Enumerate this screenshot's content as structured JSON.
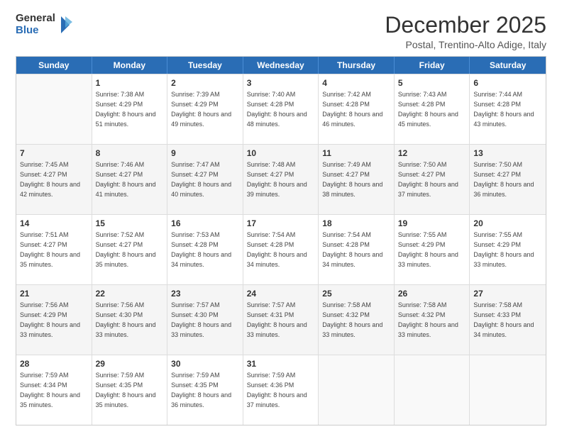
{
  "logo": {
    "general": "General",
    "blue": "Blue"
  },
  "title": "December 2025",
  "location": "Postal, Trentino-Alto Adige, Italy",
  "days": [
    "Sunday",
    "Monday",
    "Tuesday",
    "Wednesday",
    "Thursday",
    "Friday",
    "Saturday"
  ],
  "weeks": [
    [
      {
        "day": "",
        "sunrise": "",
        "sunset": "",
        "daylight": ""
      },
      {
        "day": "1",
        "sunrise": "Sunrise: 7:38 AM",
        "sunset": "Sunset: 4:29 PM",
        "daylight": "Daylight: 8 hours and 51 minutes."
      },
      {
        "day": "2",
        "sunrise": "Sunrise: 7:39 AM",
        "sunset": "Sunset: 4:29 PM",
        "daylight": "Daylight: 8 hours and 49 minutes."
      },
      {
        "day": "3",
        "sunrise": "Sunrise: 7:40 AM",
        "sunset": "Sunset: 4:28 PM",
        "daylight": "Daylight: 8 hours and 48 minutes."
      },
      {
        "day": "4",
        "sunrise": "Sunrise: 7:42 AM",
        "sunset": "Sunset: 4:28 PM",
        "daylight": "Daylight: 8 hours and 46 minutes."
      },
      {
        "day": "5",
        "sunrise": "Sunrise: 7:43 AM",
        "sunset": "Sunset: 4:28 PM",
        "daylight": "Daylight: 8 hours and 45 minutes."
      },
      {
        "day": "6",
        "sunrise": "Sunrise: 7:44 AM",
        "sunset": "Sunset: 4:28 PM",
        "daylight": "Daylight: 8 hours and 43 minutes."
      }
    ],
    [
      {
        "day": "7",
        "sunrise": "Sunrise: 7:45 AM",
        "sunset": "Sunset: 4:27 PM",
        "daylight": "Daylight: 8 hours and 42 minutes."
      },
      {
        "day": "8",
        "sunrise": "Sunrise: 7:46 AM",
        "sunset": "Sunset: 4:27 PM",
        "daylight": "Daylight: 8 hours and 41 minutes."
      },
      {
        "day": "9",
        "sunrise": "Sunrise: 7:47 AM",
        "sunset": "Sunset: 4:27 PM",
        "daylight": "Daylight: 8 hours and 40 minutes."
      },
      {
        "day": "10",
        "sunrise": "Sunrise: 7:48 AM",
        "sunset": "Sunset: 4:27 PM",
        "daylight": "Daylight: 8 hours and 39 minutes."
      },
      {
        "day": "11",
        "sunrise": "Sunrise: 7:49 AM",
        "sunset": "Sunset: 4:27 PM",
        "daylight": "Daylight: 8 hours and 38 minutes."
      },
      {
        "day": "12",
        "sunrise": "Sunrise: 7:50 AM",
        "sunset": "Sunset: 4:27 PM",
        "daylight": "Daylight: 8 hours and 37 minutes."
      },
      {
        "day": "13",
        "sunrise": "Sunrise: 7:50 AM",
        "sunset": "Sunset: 4:27 PM",
        "daylight": "Daylight: 8 hours and 36 minutes."
      }
    ],
    [
      {
        "day": "14",
        "sunrise": "Sunrise: 7:51 AM",
        "sunset": "Sunset: 4:27 PM",
        "daylight": "Daylight: 8 hours and 35 minutes."
      },
      {
        "day": "15",
        "sunrise": "Sunrise: 7:52 AM",
        "sunset": "Sunset: 4:27 PM",
        "daylight": "Daylight: 8 hours and 35 minutes."
      },
      {
        "day": "16",
        "sunrise": "Sunrise: 7:53 AM",
        "sunset": "Sunset: 4:28 PM",
        "daylight": "Daylight: 8 hours and 34 minutes."
      },
      {
        "day": "17",
        "sunrise": "Sunrise: 7:54 AM",
        "sunset": "Sunset: 4:28 PM",
        "daylight": "Daylight: 8 hours and 34 minutes."
      },
      {
        "day": "18",
        "sunrise": "Sunrise: 7:54 AM",
        "sunset": "Sunset: 4:28 PM",
        "daylight": "Daylight: 8 hours and 34 minutes."
      },
      {
        "day": "19",
        "sunrise": "Sunrise: 7:55 AM",
        "sunset": "Sunset: 4:29 PM",
        "daylight": "Daylight: 8 hours and 33 minutes."
      },
      {
        "day": "20",
        "sunrise": "Sunrise: 7:55 AM",
        "sunset": "Sunset: 4:29 PM",
        "daylight": "Daylight: 8 hours and 33 minutes."
      }
    ],
    [
      {
        "day": "21",
        "sunrise": "Sunrise: 7:56 AM",
        "sunset": "Sunset: 4:29 PM",
        "daylight": "Daylight: 8 hours and 33 minutes."
      },
      {
        "day": "22",
        "sunrise": "Sunrise: 7:56 AM",
        "sunset": "Sunset: 4:30 PM",
        "daylight": "Daylight: 8 hours and 33 minutes."
      },
      {
        "day": "23",
        "sunrise": "Sunrise: 7:57 AM",
        "sunset": "Sunset: 4:30 PM",
        "daylight": "Daylight: 8 hours and 33 minutes."
      },
      {
        "day": "24",
        "sunrise": "Sunrise: 7:57 AM",
        "sunset": "Sunset: 4:31 PM",
        "daylight": "Daylight: 8 hours and 33 minutes."
      },
      {
        "day": "25",
        "sunrise": "Sunrise: 7:58 AM",
        "sunset": "Sunset: 4:32 PM",
        "daylight": "Daylight: 8 hours and 33 minutes."
      },
      {
        "day": "26",
        "sunrise": "Sunrise: 7:58 AM",
        "sunset": "Sunset: 4:32 PM",
        "daylight": "Daylight: 8 hours and 33 minutes."
      },
      {
        "day": "27",
        "sunrise": "Sunrise: 7:58 AM",
        "sunset": "Sunset: 4:33 PM",
        "daylight": "Daylight: 8 hours and 34 minutes."
      }
    ],
    [
      {
        "day": "28",
        "sunrise": "Sunrise: 7:59 AM",
        "sunset": "Sunset: 4:34 PM",
        "daylight": "Daylight: 8 hours and 35 minutes."
      },
      {
        "day": "29",
        "sunrise": "Sunrise: 7:59 AM",
        "sunset": "Sunset: 4:35 PM",
        "daylight": "Daylight: 8 hours and 35 minutes."
      },
      {
        "day": "30",
        "sunrise": "Sunrise: 7:59 AM",
        "sunset": "Sunset: 4:35 PM",
        "daylight": "Daylight: 8 hours and 36 minutes."
      },
      {
        "day": "31",
        "sunrise": "Sunrise: 7:59 AM",
        "sunset": "Sunset: 4:36 PM",
        "daylight": "Daylight: 8 hours and 37 minutes."
      },
      {
        "day": "",
        "sunrise": "",
        "sunset": "",
        "daylight": ""
      },
      {
        "day": "",
        "sunrise": "",
        "sunset": "",
        "daylight": ""
      },
      {
        "day": "",
        "sunrise": "",
        "sunset": "",
        "daylight": ""
      }
    ]
  ]
}
